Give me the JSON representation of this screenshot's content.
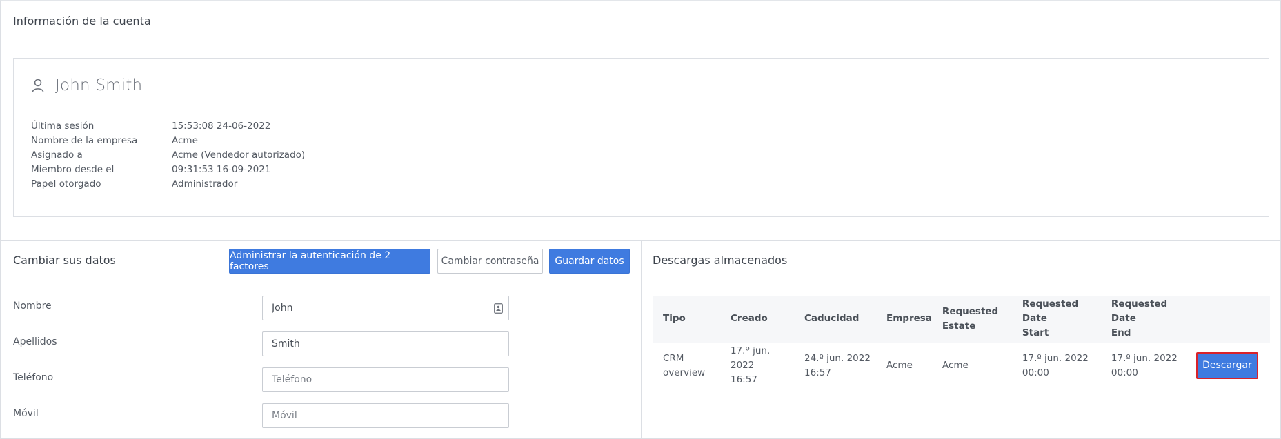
{
  "account": {
    "header": "Información de la cuenta",
    "user_name": "John Smith",
    "user_icon": "user-icon",
    "info": [
      {
        "label": "Última sesión",
        "value": "15:53:08 24-06-2022"
      },
      {
        "label": "Nombre de la empresa",
        "value": "Acme"
      },
      {
        "label": "Asignado a",
        "value": "Acme (Vendedor autorizado)"
      },
      {
        "label": "Miembro desde el",
        "value": "09:31:53 16-09-2021"
      },
      {
        "label": "Papel otorgado",
        "value": "Administrador"
      }
    ]
  },
  "change": {
    "title": "Cambiar sus datos",
    "btn_2fa": "Administrar la autenticación de 2 factores",
    "btn_password": "Cambiar contraseña",
    "btn_save": "Guardar datos",
    "fields": [
      {
        "label": "Nombre",
        "value": "John",
        "placeholder": ""
      },
      {
        "label": "Apellidos",
        "value": "Smith",
        "placeholder": ""
      },
      {
        "label": "Teléfono",
        "value": "",
        "placeholder": "Teléfono"
      },
      {
        "label": "Móvil",
        "value": "",
        "placeholder": "Móvil"
      }
    ]
  },
  "downloads": {
    "title": "Descargas almacenados",
    "headers": {
      "tipo": "Tipo",
      "creado": "Creado",
      "caducidad": "Caducidad",
      "empresa": "Empresa",
      "estate_1": "Requested",
      "estate_2": "Estate",
      "start_1": "Requested Date",
      "start_2": "Start",
      "end_1": "Requested Date",
      "end_2": "End"
    },
    "rows": [
      {
        "tipo_1": "CRM",
        "tipo_2": "overview",
        "creado_1": "17.º jun. 2022",
        "creado_2": "16:57",
        "caducidad_1": "24.º jun. 2022",
        "caducidad_2": "16:57",
        "empresa": "Acme",
        "estate": "Acme",
        "start_1": "17.º jun. 2022",
        "start_2": "00:00",
        "end_1": "17.º jun. 2022",
        "end_2": "00:00",
        "action": "Descargar"
      }
    ]
  },
  "colors": {
    "primary": "#3f7be0",
    "highlight_border": "#d9222a",
    "border": "#dcdfe4"
  }
}
